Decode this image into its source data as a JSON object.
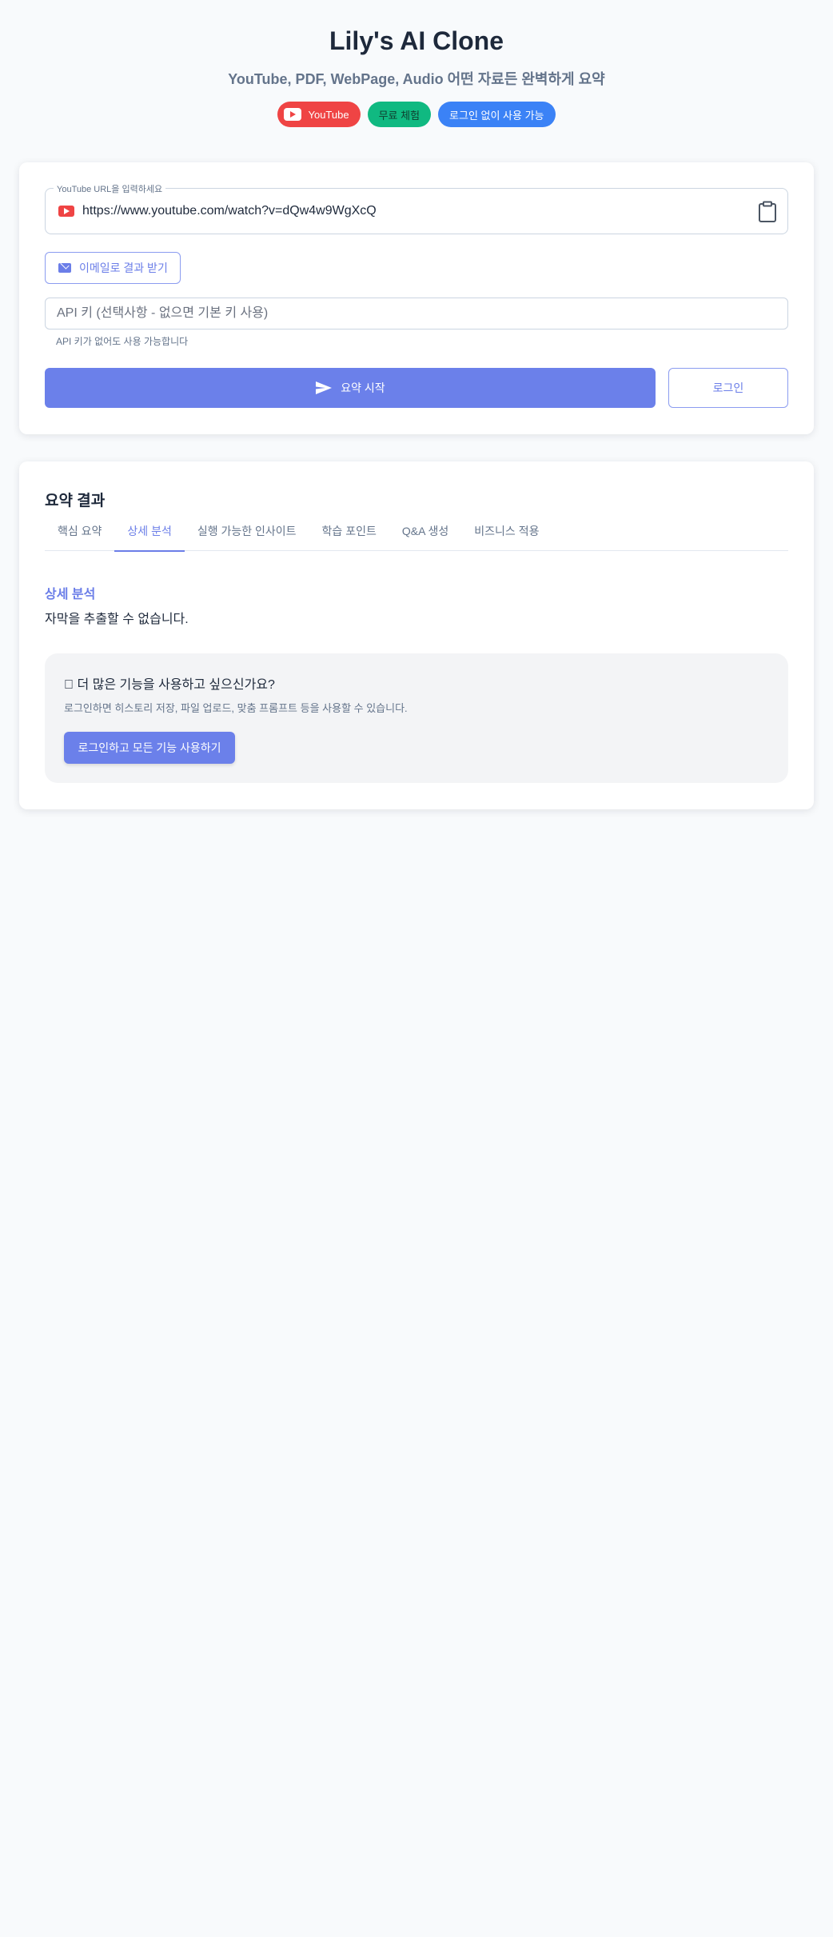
{
  "header": {
    "title": "Lily's AI Clone",
    "subtitle": "YouTube, PDF, WebPage, Audio 어떤 자료든 완벽하게 요약",
    "chips": [
      {
        "label": "YouTube",
        "color": "#ef4444",
        "icon": "youtube-icon"
      },
      {
        "label": "무료 체험",
        "color": "#10b981"
      },
      {
        "label": "로그인 없이 사용 가능",
        "color": "#3b82f6"
      }
    ]
  },
  "input_card": {
    "url_label": "YouTube URL을 입력하세요",
    "url_value": "https://www.youtube.com/watch?v=dQw4w9WgXcQ",
    "url_icon": "youtube-icon",
    "paste_icon": "clipboard-icon",
    "email_button": "이메일로 결과 받기",
    "email_icon": "mail-icon",
    "api_placeholder": "API 키 (선택사항 - 없으면 기본 키 사용)",
    "api_helper": "API 키가 없어도 사용 가능합니다",
    "submit_button": "요약 시작",
    "submit_icon": "send-icon",
    "login_button": "로그인"
  },
  "results": {
    "title": "요약 결과",
    "tabs": [
      {
        "label": "핵심 요약",
        "active": false
      },
      {
        "label": "상세 분석",
        "active": true
      },
      {
        "label": "실행 가능한 인사이트",
        "active": false
      },
      {
        "label": "학습 포인트",
        "active": false
      },
      {
        "label": "Q&A 생성",
        "active": false
      },
      {
        "label": "비즈니스 적용",
        "active": false
      }
    ],
    "section_heading": "상세 분석",
    "section_text": "자막을 추출할 수 없습니다.",
    "promo": {
      "title": "󰀀 더 많은 기능을 사용하고 싶으신가요?",
      "description": "로그인하면 히스토리 저장, 파일 업로드, 맞춤 프롬프트 등을 사용할 수 있습니다.",
      "button": "로그인하고 모든 기능 사용하기"
    }
  },
  "colors": {
    "accent": "#6b80ea",
    "background": "#f8fafc",
    "youtube": "#ef4444",
    "free": "#10b981",
    "nologin": "#3b82f6"
  }
}
